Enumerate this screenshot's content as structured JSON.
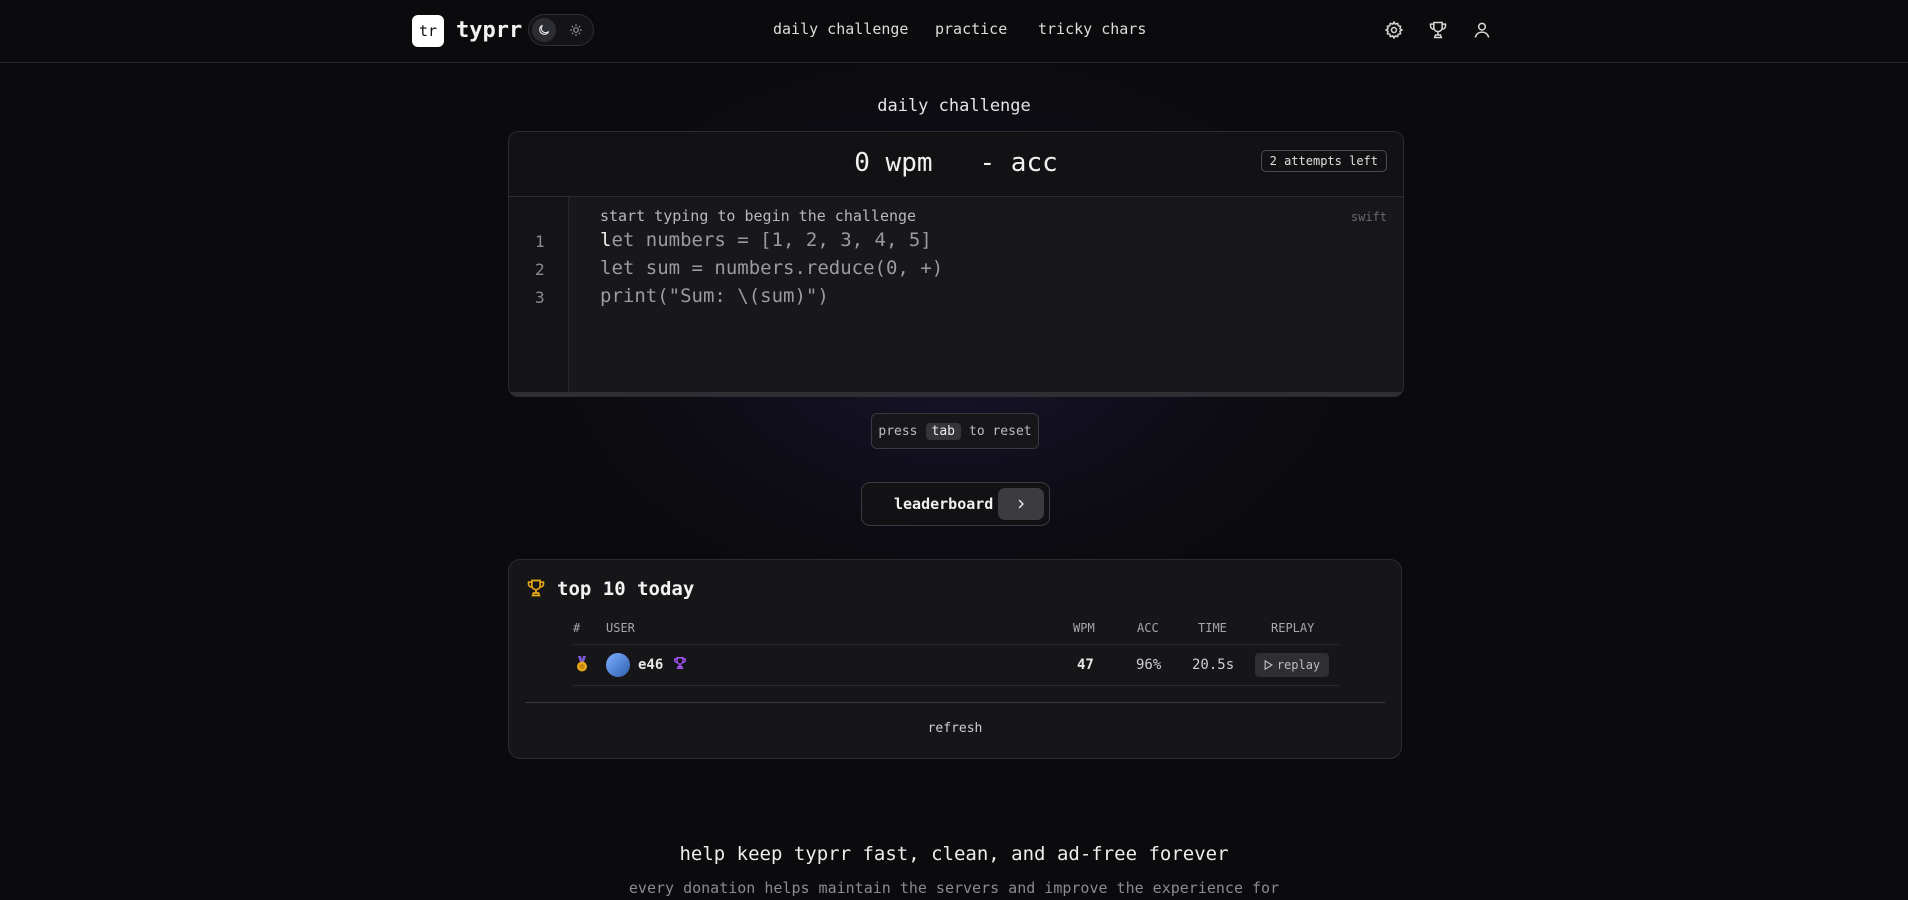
{
  "header": {
    "logo_text": "tr",
    "brand": "typrr",
    "nav": [
      "daily challenge",
      "practice",
      "tricky chars"
    ],
    "icons": [
      "gear-icon",
      "trophy-icon",
      "user-icon"
    ],
    "theme": {
      "selected": "dark",
      "options": [
        "moon-icon",
        "sun-icon"
      ]
    }
  },
  "challenge": {
    "title": "daily challenge",
    "wpm": "0 wpm",
    "acc": "- acc",
    "attempts": "2 attempts left",
    "hint": "start typing to begin the challenge",
    "language": "swift",
    "line_numbers": [
      "1",
      "2",
      "3"
    ],
    "cursor_char": "l",
    "code_lines": [
      "et numbers = [1, 2, 3, 4, 5]",
      "let sum = numbers.reduce(0, +)",
      "print(\"Sum: \\(sum)\")"
    ]
  },
  "reset_hint": {
    "pre": "press",
    "key": "tab",
    "post": "to reset"
  },
  "leaderboard_button": {
    "label": "leaderboard"
  },
  "top10": {
    "title": "top 10 today",
    "columns": [
      "#",
      "USER",
      "WPM",
      "ACC",
      "TIME",
      "REPLAY"
    ],
    "rows": [
      {
        "rank_icon": "medal-icon",
        "user": "e46",
        "wpm": "47",
        "acc": "96%",
        "time": "20.5s",
        "replay": "replay"
      }
    ],
    "refresh": "refresh"
  },
  "donate": {
    "heading": "help keep typrr fast, clean, and ad-free forever",
    "text": "every donation helps maintain the servers and improve the experience for"
  },
  "colors": {
    "background": "#0b0b0d",
    "accent_gold": "#e6a817",
    "accent_purple": "#a855f7"
  }
}
